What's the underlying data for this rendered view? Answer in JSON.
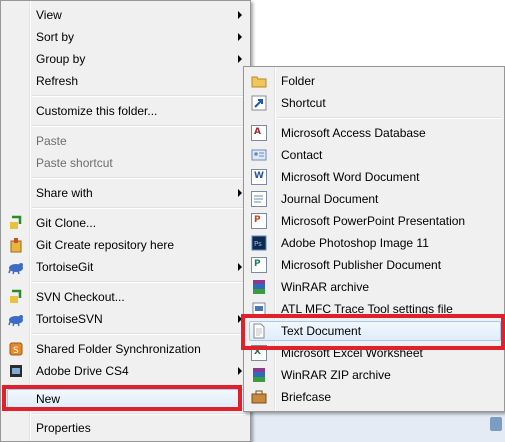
{
  "context_menu": {
    "items": [
      {
        "label": "View"
      },
      {
        "label": "Sort by"
      },
      {
        "label": "Group by"
      },
      {
        "label": "Refresh"
      },
      {
        "label": "Customize this folder..."
      },
      {
        "label": "Paste"
      },
      {
        "label": "Paste shortcut"
      },
      {
        "label": "Share with"
      },
      {
        "label": "Git Clone..."
      },
      {
        "label": "Git Create repository here"
      },
      {
        "label": "TortoiseGit"
      },
      {
        "label": "SVN Checkout..."
      },
      {
        "label": "TortoiseSVN"
      },
      {
        "label": "Shared Folder Synchronization"
      },
      {
        "label": "Adobe Drive CS4"
      },
      {
        "label": "New"
      },
      {
        "label": "Properties"
      }
    ]
  },
  "new_submenu": {
    "items": [
      {
        "label": "Folder"
      },
      {
        "label": "Shortcut"
      },
      {
        "label": "Microsoft Access Database"
      },
      {
        "label": "Contact"
      },
      {
        "label": "Microsoft Word Document"
      },
      {
        "label": "Journal Document"
      },
      {
        "label": "Microsoft PowerPoint Presentation"
      },
      {
        "label": "Adobe Photoshop Image 11"
      },
      {
        "label": "Microsoft Publisher Document"
      },
      {
        "label": "WinRAR archive"
      },
      {
        "label": "ATL MFC Trace Tool settings file"
      },
      {
        "label": "Text Document"
      },
      {
        "label": "Microsoft Excel Worksheet"
      },
      {
        "label": "WinRAR ZIP archive"
      },
      {
        "label": "Briefcase"
      }
    ]
  },
  "colors": {
    "highlight_box": "#e0202a",
    "menu_bg": "#f0f0f0",
    "hover_border": "#a8c8ec"
  }
}
